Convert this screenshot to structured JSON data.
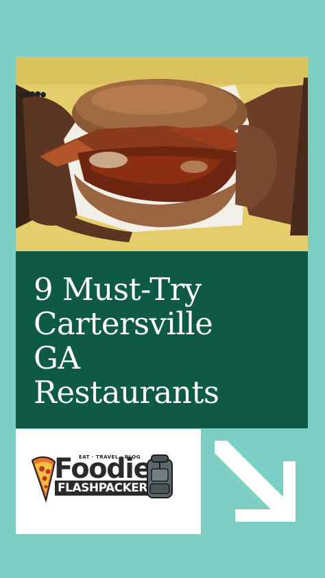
{
  "title_lines": [
    "9 Must-Try",
    "Cartersville",
    "GA",
    "Restaurants"
  ],
  "logo": {
    "tagline": "EAT · TRAVEL · BLOG",
    "word1": "Foodie",
    "word2": "FLASHPACKER"
  },
  "colors": {
    "background": "#7dcfc3",
    "title_panel": "#0e5a45",
    "title_text": "#ffffff",
    "arrow": "#ffffff"
  },
  "icons": {
    "arrow": "arrow-down-right-icon",
    "pizza": "pizza-slice-icon",
    "backpack": "backpack-icon"
  }
}
